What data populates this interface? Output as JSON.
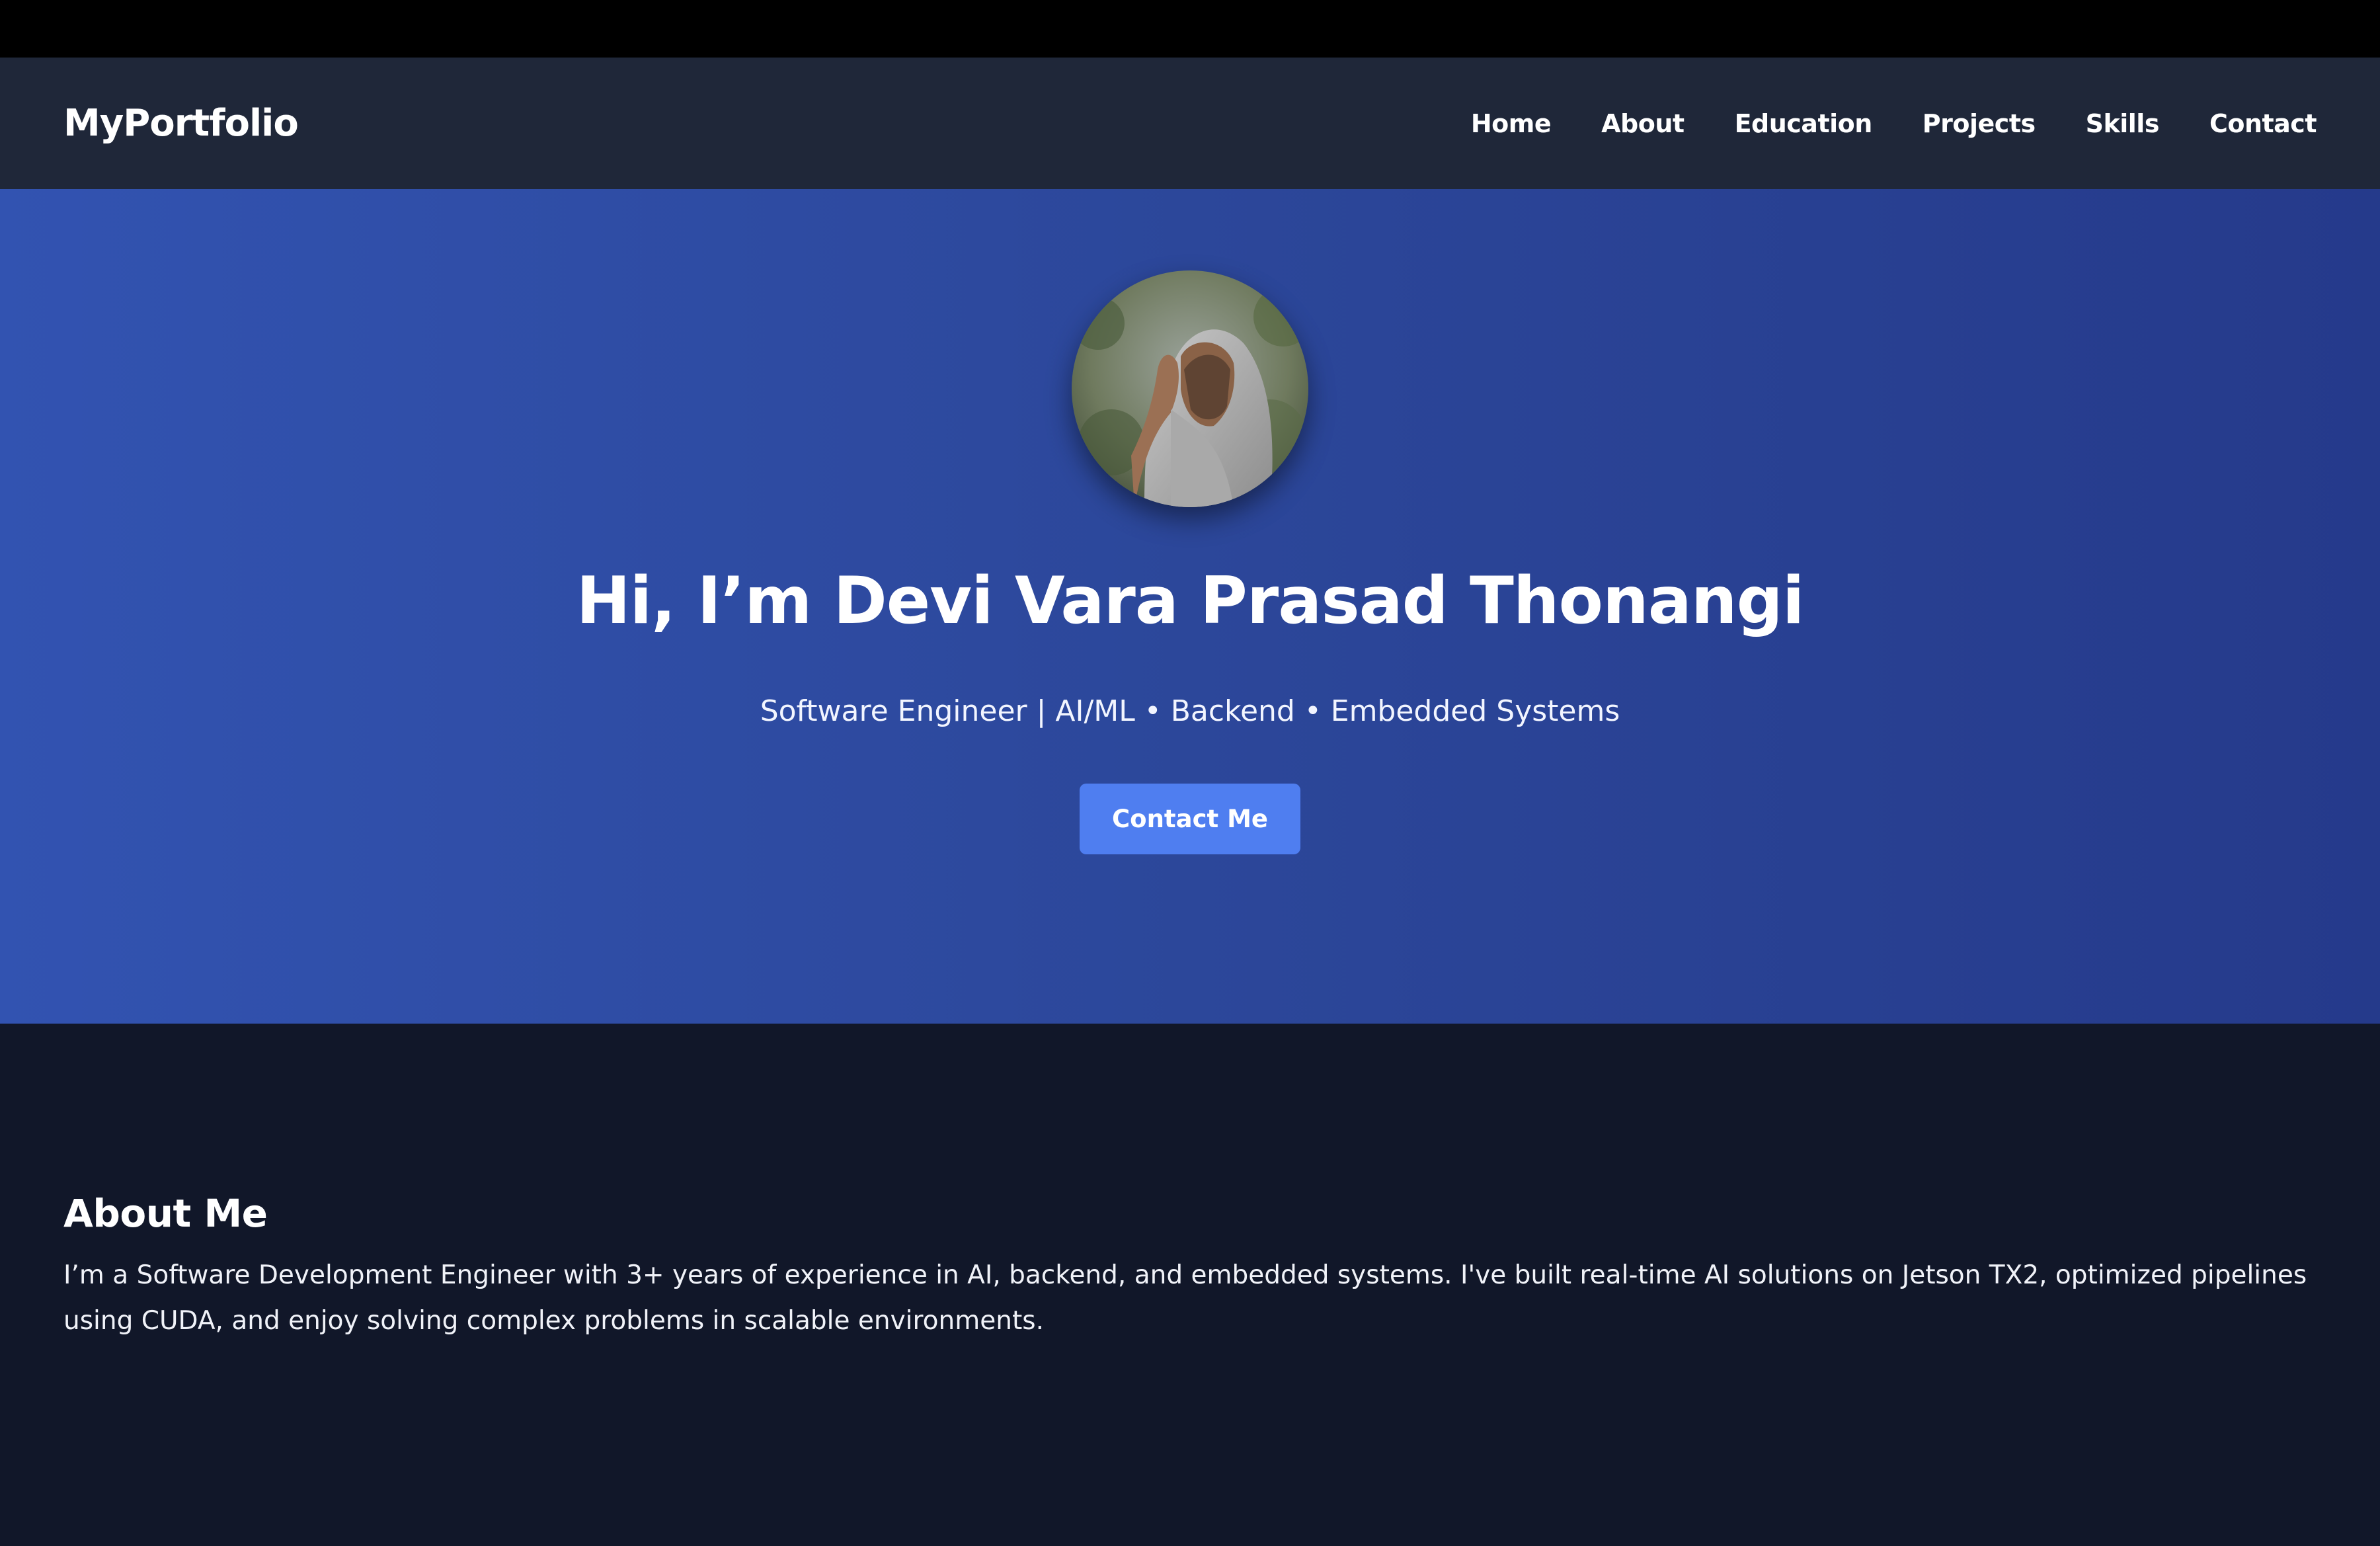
{
  "brand": "MyPortfolio",
  "nav": {
    "items": [
      {
        "label": "Home"
      },
      {
        "label": "About"
      },
      {
        "label": "Education"
      },
      {
        "label": "Projects"
      },
      {
        "label": "Skills"
      },
      {
        "label": "Contact"
      }
    ]
  },
  "hero": {
    "title": "Hi, I’m Devi Vara Prasad Thonangi",
    "subtitle": "Software Engineer | AI/ML • Backend • Embedded Systems",
    "button_label": "Contact Me"
  },
  "about": {
    "title": "About Me",
    "text": "I’m a Software Development Engineer with 3+ years of experience in AI, backend, and embedded systems. I've built real-time AI solutions on Jetson TX2, optimized pipelines using CUDA, and enjoy solving complex problems in scalable environments."
  },
  "colors": {
    "navbar": "#1f2739",
    "hero_gradient_start": "#3253b1",
    "hero_gradient_end": "#253a8b",
    "button": "#4f7ef0",
    "page_background": "#111729"
  }
}
